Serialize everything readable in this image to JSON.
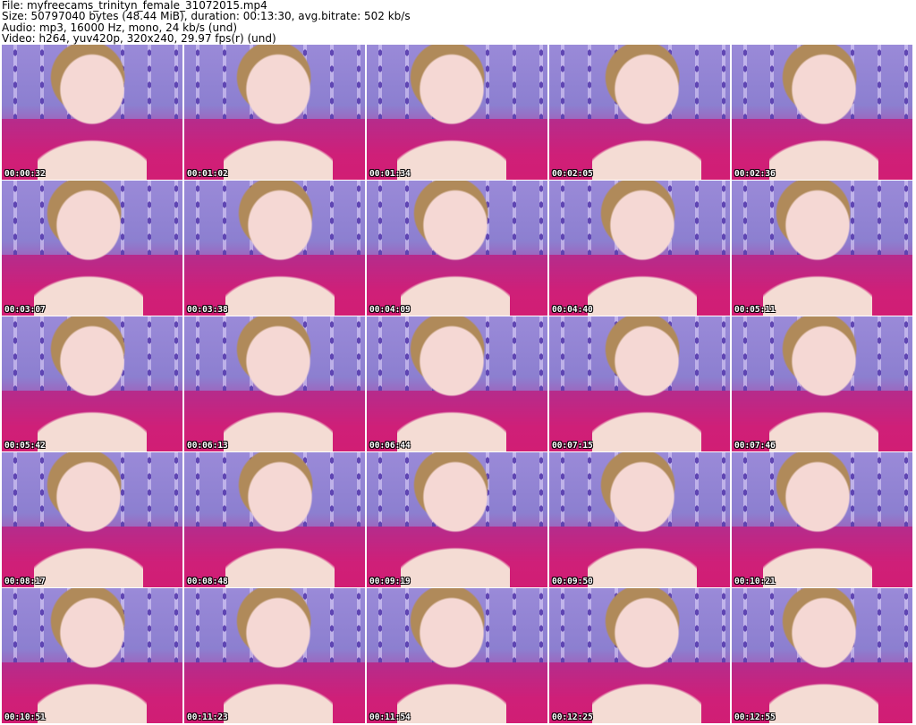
{
  "header": {
    "file_line": "File: myfreecams_trinityn_female_31072015.mp4",
    "size_line": "Size: 50797040 bytes (48.44 MiB), duration: 00:13:30, avg.bitrate: 502 kb/s",
    "audio_line": "Audio: mp3, 16000 Hz, mono, 24 kb/s (und)",
    "video_line": "Video: h264, yuv420p, 320x240, 29.97 fps(r) (und)"
  },
  "thumbnails": [
    {
      "timestamp": "00:00:32"
    },
    {
      "timestamp": "00:01:02"
    },
    {
      "timestamp": "00:01:34"
    },
    {
      "timestamp": "00:02:05"
    },
    {
      "timestamp": "00:02:36"
    },
    {
      "timestamp": "00:03:07"
    },
    {
      "timestamp": "00:03:38"
    },
    {
      "timestamp": "00:04:09"
    },
    {
      "timestamp": "00:04:40"
    },
    {
      "timestamp": "00:05:11"
    },
    {
      "timestamp": "00:05:42"
    },
    {
      "timestamp": "00:06:13"
    },
    {
      "timestamp": "00:06:44"
    },
    {
      "timestamp": "00:07:15"
    },
    {
      "timestamp": "00:07:46"
    },
    {
      "timestamp": "00:08:17"
    },
    {
      "timestamp": "00:08:48"
    },
    {
      "timestamp": "00:09:19"
    },
    {
      "timestamp": "00:09:50"
    },
    {
      "timestamp": "00:10:21"
    },
    {
      "timestamp": "00:10:51"
    },
    {
      "timestamp": "00:11:23"
    },
    {
      "timestamp": "00:11:54"
    },
    {
      "timestamp": "00:12:25"
    },
    {
      "timestamp": "00:12:55"
    }
  ],
  "colors": {
    "background": "#ffffff",
    "wall": "#8c7fd0",
    "sofa": "#cf1f78",
    "timestamp_text": "#ffffff"
  }
}
